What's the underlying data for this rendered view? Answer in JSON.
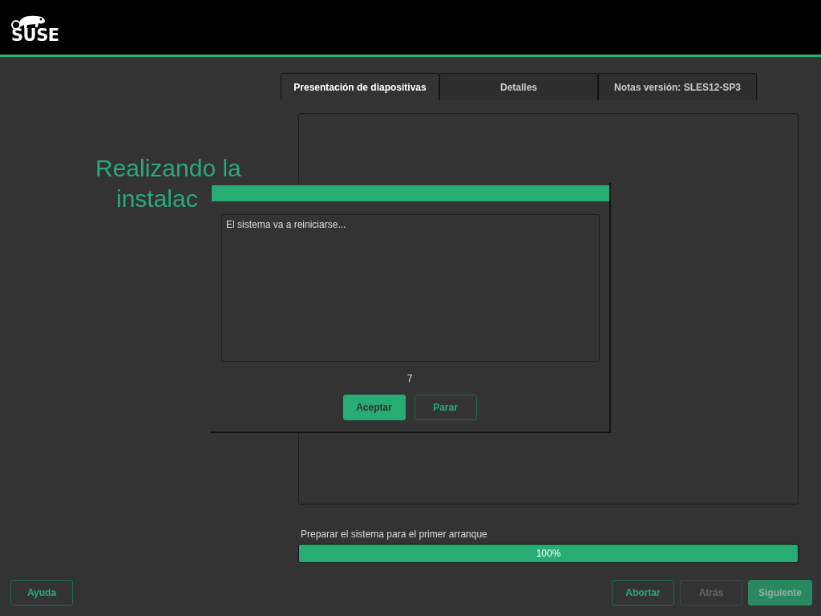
{
  "header": {
    "logo": "SUSE"
  },
  "heading": {
    "lines": [
      "Realizando la",
      "instalac"
    ]
  },
  "tabs": [
    {
      "label": "Presentación de diapositivas",
      "selected": true
    },
    {
      "label": "Detalles",
      "selected": false
    },
    {
      "label": "Notas versión: SLES12-SP3",
      "selected": false
    }
  ],
  "progress": {
    "label": "Preparar el sistema para el primer arranque",
    "level": 1,
    "reading": "100%"
  },
  "help_button": {
    "label": "Ayuda",
    "kind": "outline",
    "disabled": false
  },
  "nav_buttons": [
    {
      "label": "Abortar",
      "kind": "outline",
      "disabled": false
    },
    {
      "label": "Atrás",
      "kind": "outline",
      "disabled": true
    },
    {
      "label": "Siguiente",
      "kind": "primary",
      "disabled": true
    }
  ],
  "dialog": {
    "message": "El sistema va a reiniciarse...",
    "countdown": "7",
    "buttons": [
      {
        "label": "Aceptar",
        "kind": "primary",
        "disabled": false
      },
      {
        "label": "Parar",
        "kind": "outline",
        "disabled": false
      }
    ]
  }
}
